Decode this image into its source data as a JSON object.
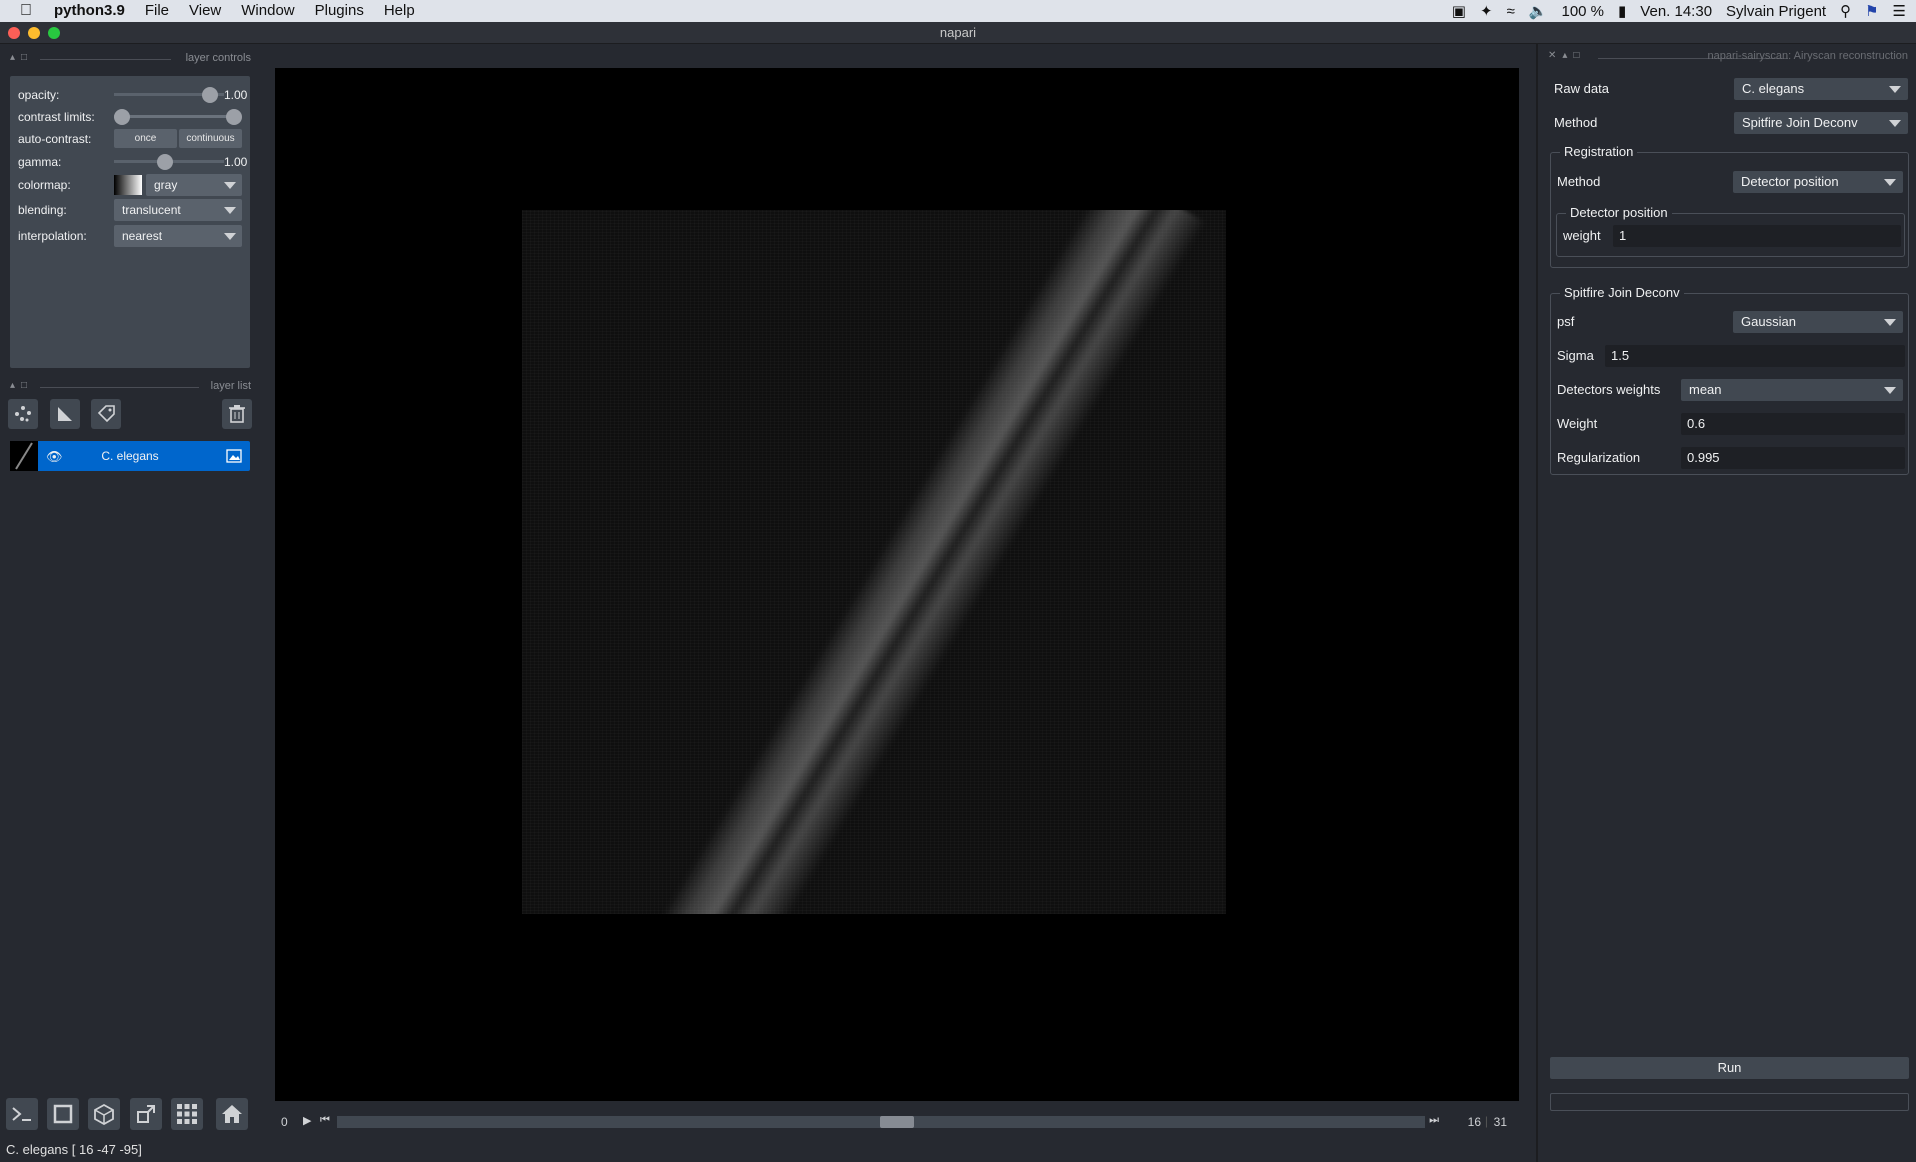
{
  "menubar": {
    "app": "python3.9",
    "items": [
      "File",
      "View",
      "Window",
      "Plugins",
      "Help"
    ],
    "battery": "100 %",
    "clock": "Ven. 14:30",
    "user": "Sylvain Prigent"
  },
  "window": {
    "title": "napari"
  },
  "left_dock": {
    "layer_controls_title": "layer controls",
    "layer_list_title": "layer list",
    "controls": {
      "opacity_label": "opacity:",
      "opacity_value": "1.00",
      "opacity": 1.0,
      "contrast_label": "contrast limits:",
      "contrast_range": [
        0.0,
        1.0
      ],
      "autocontrast_label": "auto-contrast:",
      "once": "once",
      "continuous": "continuous",
      "gamma_label": "gamma:",
      "gamma_value": "1.00",
      "gamma": 0.45,
      "colormap_label": "colormap:",
      "colormap_value": "gray",
      "blending_label": "blending:",
      "blending_value": "translucent",
      "interpolation_label": "interpolation:",
      "interpolation_value": "nearest"
    },
    "layers": [
      {
        "name": "C. elegans",
        "visible": true
      }
    ]
  },
  "dims": {
    "current": "0",
    "position": 16,
    "max": "31",
    "position_text": "16"
  },
  "status": "C. elegans [ 16 -47 -95]",
  "activity": "activity",
  "plugin": {
    "title": "napari-sairyscan: Airyscan reconstruction",
    "raw_data_label": "Raw data",
    "raw_data_value": "C. elegans",
    "method_label": "Method",
    "method_value": "Spitfire Join Deconv",
    "registration": {
      "title": "Registration",
      "method_label": "Method",
      "method_value": "Detector position",
      "detector_title": "Detector position",
      "weight_label": "weight",
      "weight_value": "1"
    },
    "spitfire": {
      "title": "Spitfire Join Deconv",
      "psf_label": "psf",
      "psf_value": "Gaussian",
      "sigma_label": "Sigma",
      "sigma_value": "1.5",
      "det_weights_label": "Detectors weights",
      "det_weights_value": "mean",
      "weight_label": "Weight",
      "weight_value": "0.6",
      "reg_label": "Regularization",
      "reg_value": "0.995"
    },
    "run": "Run"
  },
  "colors": {
    "accent": "#0066cc",
    "panel": "#414851",
    "bg": "#262930"
  }
}
